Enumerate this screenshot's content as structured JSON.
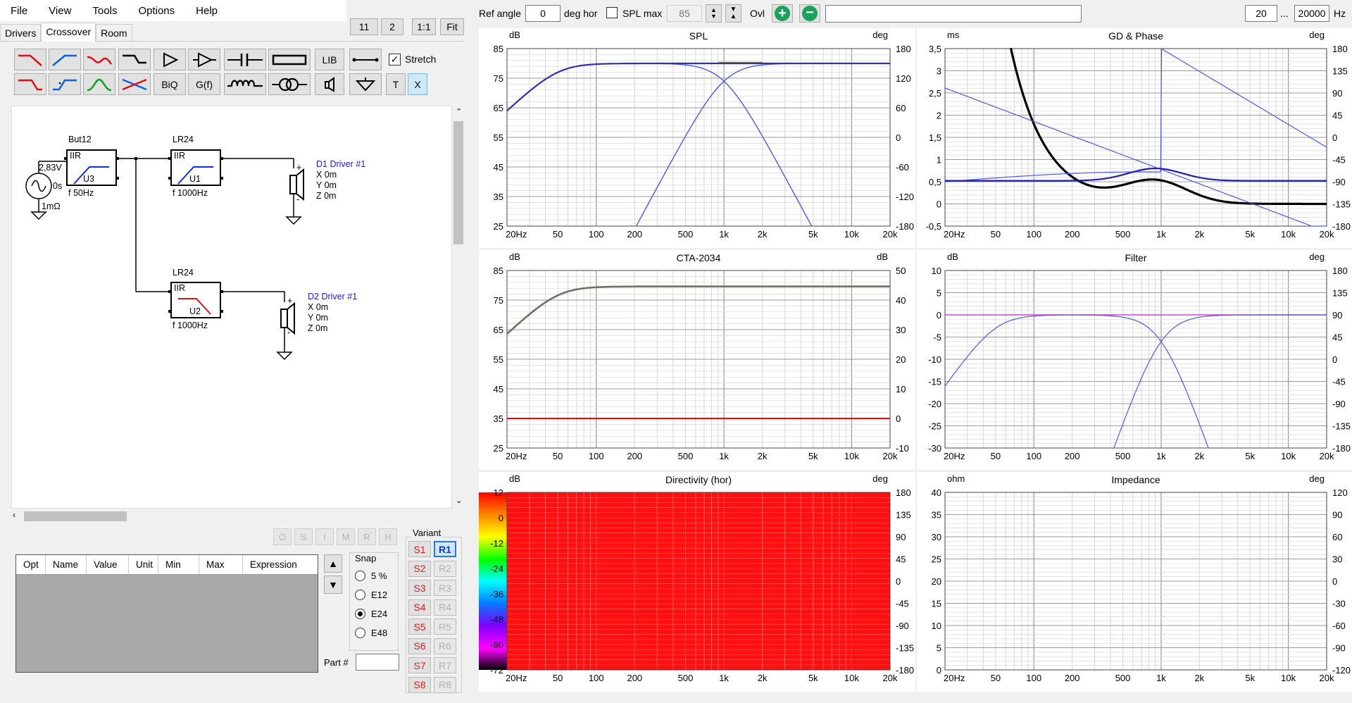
{
  "menu": [
    "File",
    "View",
    "Tools",
    "Options",
    "Help"
  ],
  "tabs": [
    "Drivers",
    "Crossover",
    "Room"
  ],
  "view_buttons": [
    "11",
    "2",
    "1:1",
    "Fit"
  ],
  "toolbar": {
    "lib_label": "LIB",
    "stretch_label": "Stretch",
    "biq_label": "BiQ",
    "gf_label": "G(f)",
    "t_label": "T",
    "x_label": "X"
  },
  "schematic": {
    "source": {
      "voltage": "2,83V",
      "delay": "0s",
      "resistance": "1mΩ"
    },
    "blocks": [
      {
        "name": "But12",
        "type": "IIR",
        "unit": "U3",
        "freq_label": "f   50Hz"
      },
      {
        "name": "LR24",
        "type": "IIR",
        "unit": "U1",
        "freq_label": "f   1000Hz"
      },
      {
        "name": "LR24",
        "type": "IIR",
        "unit": "U2",
        "freq_label": "f   1000Hz"
      }
    ],
    "drivers": [
      {
        "name": "D1 Driver #1",
        "x": "X  0m",
        "y": "Y  0m",
        "z": "Z  0m"
      },
      {
        "name": "D2 Driver #1",
        "x": "X  0m",
        "y": "Y  0m",
        "z": "Z  0m"
      }
    ],
    "plus": "+",
    "minus": "-"
  },
  "layer_buttons": [
    "O",
    "S",
    "I",
    "M",
    "R",
    "H"
  ],
  "param_columns": [
    "Opt",
    "Name",
    "Value",
    "Unit",
    "Min",
    "Max",
    "Expression"
  ],
  "snap": {
    "title": "Snap",
    "options": [
      "5 %",
      "E12",
      "E24",
      "E48"
    ],
    "selected": "E24"
  },
  "part_label": "Part #",
  "variant": {
    "title": "Variant",
    "s": [
      "S1",
      "S2",
      "S3",
      "S4",
      "S5",
      "S6",
      "S7",
      "S8"
    ],
    "r": [
      "R1",
      "R2",
      "R3",
      "R4",
      "R5",
      "R6",
      "R7",
      "R8"
    ],
    "selected": "R1"
  },
  "top": {
    "ref_angle_label": "Ref angle",
    "ref_angle": "0",
    "deg_hor": "deg hor",
    "spl_max_label": "SPL max",
    "spl_max": "85",
    "ovl": "Ovl",
    "freq_min": "20",
    "ellipsis": "...",
    "freq_max": "20000",
    "hz": "Hz"
  },
  "x_ticks": [
    "20Hz",
    "50",
    "100",
    "200",
    "500",
    "1k",
    "2k",
    "5k",
    "10k",
    "20k"
  ],
  "charts": [
    {
      "id": "spl",
      "title": "SPL",
      "left_unit": "dB",
      "right_unit": "deg",
      "left_ticks": [
        "85",
        "75",
        "65",
        "55",
        "45",
        "35",
        "25"
      ],
      "right_ticks": [
        "180",
        "120",
        "60",
        "0",
        "-60",
        "-120",
        "-180"
      ]
    },
    {
      "id": "gd",
      "title": "GD & Phase",
      "left_unit": "ms",
      "right_unit": "deg",
      "left_ticks": [
        "3,5",
        "3",
        "2,5",
        "2",
        "1,5",
        "1",
        "0,5",
        "0",
        "-0,5"
      ],
      "right_ticks": [
        "180",
        "135",
        "90",
        "45",
        "0",
        "-45",
        "-90",
        "-135",
        "-180"
      ]
    },
    {
      "id": "cta",
      "title": "CTA-2034",
      "left_unit": "dB",
      "right_unit": "dB",
      "left_ticks": [
        "85",
        "75",
        "65",
        "55",
        "45",
        "35",
        "25"
      ],
      "right_ticks": [
        "50",
        "40",
        "30",
        "20",
        "10",
        "0",
        "-10"
      ]
    },
    {
      "id": "filter",
      "title": "Filter",
      "left_unit": "dB",
      "right_unit": "deg",
      "left_ticks": [
        "10",
        "5",
        "0",
        "-5",
        "-10",
        "-15",
        "-20",
        "-25",
        "-30"
      ],
      "right_ticks": [
        "180",
        "135",
        "90",
        "45",
        "0",
        "-45",
        "-90",
        "-135",
        "-180"
      ]
    },
    {
      "id": "dir",
      "title": "Directivity (hor)",
      "left_unit": "dB",
      "right_unit": "deg",
      "left_ticks": [
        "12",
        "0",
        "-12",
        "-24",
        "-36",
        "-48",
        "-60",
        "-72"
      ],
      "right_ticks": [
        "180",
        "135",
        "90",
        "45",
        "0",
        "-45",
        "-90",
        "-135",
        "-180"
      ]
    },
    {
      "id": "imp",
      "title": "Impedance",
      "left_unit": "ohm",
      "right_unit": "deg",
      "left_ticks": [
        "40",
        "35",
        "30",
        "25",
        "20",
        "15",
        "10",
        "5",
        "0"
      ],
      "right_ticks": [
        "120",
        "90",
        "60",
        "30",
        "0",
        "-30",
        "-60",
        "-90",
        "-120"
      ]
    }
  ],
  "colors": {
    "curve_blue": "#4a5ae8",
    "black": "#000000",
    "red": "#ff0000",
    "cta_gray": "#707060",
    "magenta": "#d040d0",
    "dir_fill": "#ff0f0f"
  }
}
